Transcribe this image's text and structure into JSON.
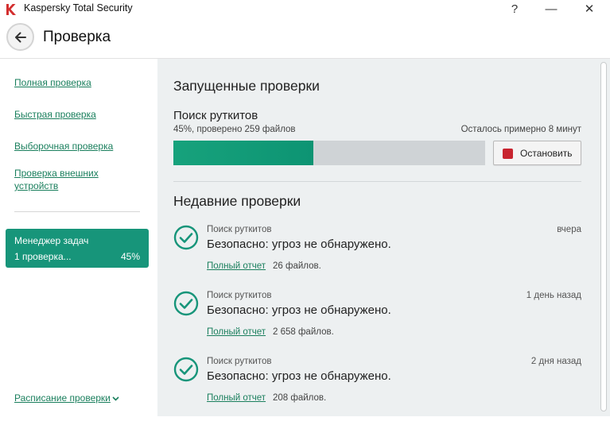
{
  "window": {
    "title": "Kaspersky Total Security",
    "help": "?",
    "minimize": "—",
    "close": "✕"
  },
  "header": {
    "title": "Проверка"
  },
  "sidebar": {
    "links": [
      "Полная проверка",
      "Быстрая проверка",
      "Выборочная проверка",
      "Проверка внешних устройств"
    ],
    "task_manager": {
      "title": "Менеджер задач",
      "subtitle": "1 проверка...",
      "percent": "45%"
    },
    "schedule": "Расписание проверки"
  },
  "running": {
    "heading": "Запущенные проверки",
    "scan_name": "Поиск руткитов",
    "progress_text": "45%, проверено 259 файлов",
    "remaining": "Осталось примерно 8 минут",
    "progress_fraction": 0.45,
    "stop_label": "Остановить"
  },
  "recent": {
    "heading": "Недавние проверки",
    "items": [
      {
        "type": "Поиск руткитов",
        "time": "вчера",
        "result": "Безопасно: угроз не обнаружено.",
        "report": "Полный отчет",
        "files": "26 файлов."
      },
      {
        "type": "Поиск руткитов",
        "time": "1 день назад",
        "result": "Безопасно: угроз не обнаружено.",
        "report": "Полный отчет",
        "files": "2 658 файлов."
      },
      {
        "type": "Поиск руткитов",
        "time": "2 дня назад",
        "result": "Безопасно: угроз не обнаружено.",
        "report": "Полный отчет",
        "files": "208 файлов."
      }
    ]
  },
  "colors": {
    "accent": "#17957a",
    "link": "#1a7f5d",
    "stop": "#c8242f",
    "brand": "#d32f2f"
  }
}
